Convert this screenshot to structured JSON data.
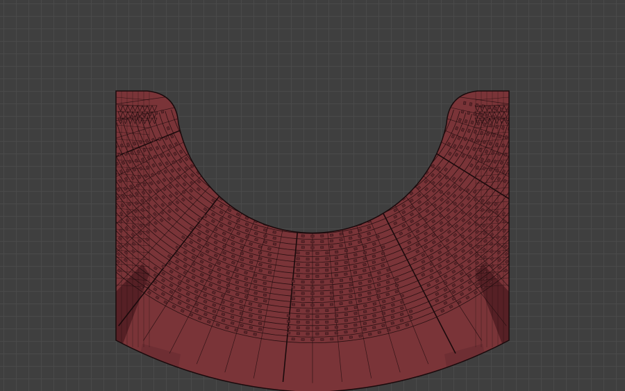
{
  "viewport": {
    "background_color": "#3f3f3f",
    "grid_minor_color": "#4a4a4a",
    "grid_major_color": "#5a5a5a"
  },
  "mesh": {
    "name": "auditorium-seating-mesh",
    "view": "top-orthographic",
    "wireframe_overlay": true,
    "face_color": "#7a3438",
    "face_shade_color": "#6d2e33",
    "edge_color": "#1a0a0c",
    "seat_color": "#5e262b",
    "accent_color": "#4e1c20"
  }
}
